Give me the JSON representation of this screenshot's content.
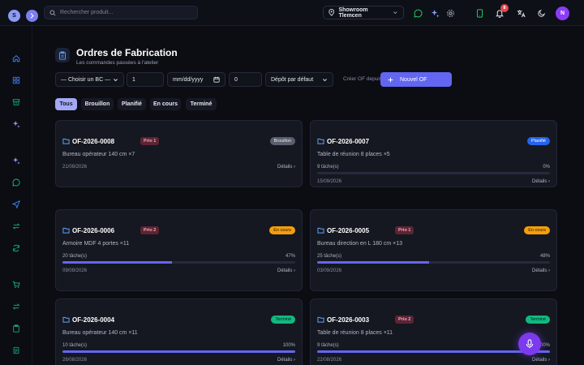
{
  "topbar": {
    "brand_letter": "S",
    "search_placeholder": "Rechercher produit...",
    "showroom": "Showroom Tlemcen",
    "notification_count": "8",
    "avatar_letter": "N"
  },
  "header": {
    "title": "Ordres de Fabrication",
    "subtitle": "Les commandes passées à l'atelier"
  },
  "controls": {
    "bc_select": "— Choisir un BC —",
    "quantity_1": "1",
    "date_placeholder": "mm/dd/yyyy",
    "quantity_2": "0",
    "depot_select": "Dépôt par défaut",
    "create_from_bc": "Créer OF depuis BC",
    "new_of": "Nouvel OF"
  },
  "tabs": [
    {
      "label": "Tous"
    },
    {
      "label": "Brouillon"
    },
    {
      "label": "Planifié"
    },
    {
      "label": "En cours"
    },
    {
      "label": "Terminé"
    }
  ],
  "cards": [
    {
      "id": "OF-2026-0008",
      "prio": "Prio 1",
      "status": "Brouillon",
      "product": "Bureau opérateur 140 cm ×7",
      "tasks": "",
      "percent": "",
      "progress": 0,
      "date": "21/09/2026",
      "details": "Détails ›"
    },
    {
      "id": "OF-2026-0007",
      "prio": "",
      "status": "Planifié",
      "product": "Table de réunion 8 places ×5",
      "tasks": "9 tâche(s)",
      "percent": "0%",
      "progress": 0,
      "date": "15/09/2026",
      "details": "Détails ›"
    },
    {
      "id": "OF-2026-0006",
      "prio": "Prio 2",
      "status": "En cours",
      "product": "Armoire MDF 4 portes ×11",
      "tasks": "20 tâche(s)",
      "percent": "47%",
      "progress": 0.47,
      "date": "09/09/2026",
      "details": "Détails ›"
    },
    {
      "id": "OF-2026-0005",
      "prio": "Prio 1",
      "status": "En cours",
      "product": "Bureau direction en L 180 cm ×13",
      "tasks": "25 tâche(s)",
      "percent": "48%",
      "progress": 0.48,
      "date": "03/09/2026",
      "details": "Détails ›"
    },
    {
      "id": "OF-2026-0004",
      "prio": "",
      "status": "Terminé",
      "product": "Bureau opérateur 140 cm ×11",
      "tasks": "10 tâche(s)",
      "percent": "100%",
      "progress": 1,
      "date": "28/08/2026",
      "details": "Détails ›"
    },
    {
      "id": "OF-2026-0003",
      "prio": "Prio 2",
      "status": "Terminé",
      "product": "Table de réunion 8 places ×11",
      "tasks": "9 tâche(s)",
      "percent": "100%",
      "progress": 1,
      "date": "22/08/2026",
      "details": "Détails ›"
    }
  ],
  "colors": {
    "accent": "#6366f1",
    "background": "#0b0d13",
    "card": "#151821",
    "status_brouillon": "#5a5f6e",
    "status_planifie": "#2563eb",
    "status_en_cours": "#f59e0b",
    "status_termine": "#10b981",
    "prio": "#5b2533"
  }
}
